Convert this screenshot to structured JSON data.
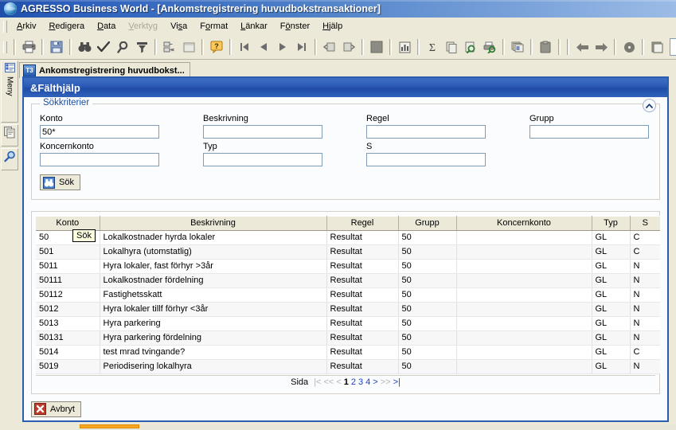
{
  "window": {
    "app_name": "AGRESSO Business World",
    "title": "AGRESSO Business World - [Ankomstregistrering huvudbokstransaktioner]",
    "logo_icon": "globe-icon"
  },
  "menubar": {
    "items": [
      {
        "label": "Arkiv",
        "accel": "A",
        "disabled": false
      },
      {
        "label": "Redigera",
        "accel": "R",
        "disabled": false
      },
      {
        "label": "Data",
        "accel": "D",
        "disabled": false
      },
      {
        "label": "Verktyg",
        "accel": "V",
        "disabled": true
      },
      {
        "label": "Visa",
        "accel": "s",
        "disabled": false
      },
      {
        "label": "Format",
        "accel": "o",
        "disabled": false
      },
      {
        "label": "Länkar",
        "accel": "L",
        "disabled": false
      },
      {
        "label": "Fönster",
        "accel": "ö",
        "disabled": false
      },
      {
        "label": "Hjälp",
        "accel": "H",
        "disabled": false
      }
    ]
  },
  "toolbar": {
    "buttons": [
      {
        "name": "print-icon",
        "tip": "Skriv ut"
      },
      {
        "name": "save-icon",
        "tip": "Spara"
      },
      {
        "name": "binoculars-search-icon",
        "tip": "Sök"
      },
      {
        "name": "checkmark-icon",
        "tip": "Verkställ"
      },
      {
        "name": "magnifier-icon",
        "tip": "Zooma"
      },
      {
        "name": "filter-icon",
        "tip": "Filter"
      },
      {
        "name": "expand-tree-icon",
        "tip": "Expandera"
      },
      {
        "name": "blank-window-icon",
        "tip": "Fönster"
      },
      {
        "name": "help-question-icon",
        "tip": "Hjälp"
      },
      {
        "name": "first-record-icon",
        "tip": "Första"
      },
      {
        "name": "previous-record-icon",
        "tip": "Föregående"
      },
      {
        "name": "next-record-icon",
        "tip": "Nästa"
      },
      {
        "name": "last-record-icon",
        "tip": "Sista"
      },
      {
        "name": "undo-refresh-icon",
        "tip": "Ångra"
      },
      {
        "name": "redo-refresh-icon",
        "tip": "Gör om"
      },
      {
        "name": "stop-square-icon",
        "tip": "Stopp"
      },
      {
        "name": "chart-bar-icon",
        "tip": "Diagram"
      },
      {
        "name": "sum-sigma-icon",
        "tip": "Summa"
      },
      {
        "name": "copy-icon",
        "tip": "Kopiera"
      },
      {
        "name": "print-preview-icon",
        "tip": "Förhandsgranska"
      },
      {
        "name": "print-report-icon",
        "tip": "Skriv ut rapport"
      },
      {
        "name": "cascade-windows-icon",
        "tip": "Ordna fönster"
      },
      {
        "name": "clipboard-paste-icon",
        "tip": "Klistra in"
      },
      {
        "name": "back-arrow-icon",
        "tip": "Bakåt"
      },
      {
        "name": "forward-arrow-icon",
        "tip": "Framåt"
      },
      {
        "name": "record-dot-icon",
        "tip": "Spela in"
      },
      {
        "name": "document-icon",
        "tip": "Dokument"
      }
    ],
    "field_value": ""
  },
  "left_dock": {
    "items": [
      {
        "name": "menu-panel-icon",
        "label": "Meny"
      },
      {
        "name": "copy-panel-icon",
        "label": ""
      },
      {
        "name": "search-panel-icon",
        "label": ""
      }
    ]
  },
  "tabs": [
    {
      "label": "Ankomstregistrering huvudbokst...",
      "icon": "t3-icon",
      "active": true
    }
  ],
  "mdi": {
    "title": "&Fälthjälp"
  },
  "search_criteria": {
    "legend": "Sökkriterier",
    "collapse_icon": "chevron-up-icon",
    "fields": [
      {
        "label": "Konto",
        "value": "50*",
        "placeholder": ""
      },
      {
        "label": "Beskrivning",
        "value": "",
        "placeholder": ""
      },
      {
        "label": "Regel",
        "value": "",
        "placeholder": ""
      },
      {
        "label": "Grupp",
        "value": "",
        "placeholder": ""
      },
      {
        "label": "Koncernkonto",
        "value": "",
        "placeholder": ""
      },
      {
        "label": "Typ",
        "value": "",
        "placeholder": ""
      },
      {
        "label": "S",
        "value": "",
        "placeholder": ""
      }
    ],
    "search_button": {
      "label": "Sök",
      "icon": "binoculars-search-icon"
    },
    "tooltip": "Sök"
  },
  "results": {
    "columns": [
      "Konto",
      "Beskrivning",
      "Regel",
      "Grupp",
      "Koncernkonto",
      "Typ",
      "S"
    ],
    "rows": [
      {
        "Konto": "50",
        "Beskrivning": "Lokalkostnader hyrda lokaler",
        "Regel": "Resultat",
        "Grupp": "50",
        "Koncernkonto": "",
        "Typ": "GL",
        "S": "C"
      },
      {
        "Konto": "501",
        "Beskrivning": "Lokalhyra (utomstatlig)",
        "Regel": "Resultat",
        "Grupp": "50",
        "Koncernkonto": "",
        "Typ": "GL",
        "S": "C"
      },
      {
        "Konto": "5011",
        "Beskrivning": "Hyra lokaler, fast förhyr >3år",
        "Regel": "Resultat",
        "Grupp": "50",
        "Koncernkonto": "",
        "Typ": "GL",
        "S": "N"
      },
      {
        "Konto": "50111",
        "Beskrivning": "Lokalkostnader fördelning",
        "Regel": "Resultat",
        "Grupp": "50",
        "Koncernkonto": "",
        "Typ": "GL",
        "S": "N"
      },
      {
        "Konto": "50112",
        "Beskrivning": "Fastighetsskatt",
        "Regel": "Resultat",
        "Grupp": "50",
        "Koncernkonto": "",
        "Typ": "GL",
        "S": "N"
      },
      {
        "Konto": "5012",
        "Beskrivning": "Hyra lokaler tillf förhyr <3år",
        "Regel": "Resultat",
        "Grupp": "50",
        "Koncernkonto": "",
        "Typ": "GL",
        "S": "N"
      },
      {
        "Konto": "5013",
        "Beskrivning": "Hyra parkering",
        "Regel": "Resultat",
        "Grupp": "50",
        "Koncernkonto": "",
        "Typ": "GL",
        "S": "N"
      },
      {
        "Konto": "50131",
        "Beskrivning": "Hyra parkering fördelning",
        "Regel": "Resultat",
        "Grupp": "50",
        "Koncernkonto": "",
        "Typ": "GL",
        "S": "N"
      },
      {
        "Konto": "5014",
        "Beskrivning": "test mrad tvingande?",
        "Regel": "Resultat",
        "Grupp": "50",
        "Koncernkonto": "",
        "Typ": "GL",
        "S": "C"
      },
      {
        "Konto": "5019",
        "Beskrivning": "Periodisering lokalhyra",
        "Regel": "Resultat",
        "Grupp": "50",
        "Koncernkonto": "",
        "Typ": "GL",
        "S": "N"
      }
    ]
  },
  "pager": {
    "label": "Sida",
    "first": "|<",
    "prev_block": "<<",
    "prev": "<",
    "pages": [
      "1",
      "2",
      "3",
      "4"
    ],
    "current_page": "1",
    "next": ">",
    "next_block": ">>",
    "last": ">|"
  },
  "footer": {
    "cancel_button": {
      "label": "Avbryt",
      "icon": "cancel-x-icon"
    }
  },
  "colors": {
    "title_blue": "#1f4fa8",
    "panel_blue": "#2a59b4",
    "link_blue": "#1a3fd0",
    "legend_blue": "#1c4ea0",
    "face": "#ece9d8",
    "scroll_orange": "#f5a623"
  }
}
